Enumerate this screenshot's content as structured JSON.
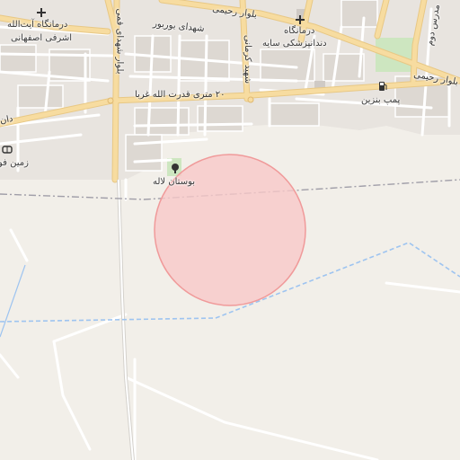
{
  "map": {
    "colors": {
      "land": "#f2efe9",
      "urban": "#e6e2dd",
      "block": "#dcd7d1",
      "major_road": "#f7dca0",
      "major_road_casing": "#e5c27d",
      "minor_road": "#ffffff",
      "park": "#cfe8c2",
      "railway": "#9c9aa6",
      "boundary": "#9ec4f0",
      "highlight_fill": "#f8c8c8",
      "highlight_stroke": "#f09a9a"
    },
    "labels": {
      "hospital_ayatollah_line1": "درمانگاه آیت‌الله",
      "hospital_ayatollah_line2": "اشرفی اصفهانی",
      "boulevard_rahimi_top": "بلوار رحیمی",
      "shohada_boroujer": "شهدای بوربور",
      "clinic_line1": "درمانگاه",
      "clinic_line2": "دندانپزشکی سایه",
      "street_20m": "۲۰ متری قدرت الله غربا",
      "gas_station": "پمپ بنزین",
      "boulevard_rahimi_right": "بلوار رحیمی",
      "shohada_qom_vertical": "بلوار شهدای قمی",
      "shohid_vertical": "شهید کرمانی",
      "madras_vertical": "مدرس دوم",
      "bostan_laleh": "بوستان لاله",
      "zamin_label": "زمین فو",
      "dana_label": "دان"
    },
    "icons": [
      "hospital-cross-icon",
      "clinic-cross-icon",
      "gas-pump-icon",
      "park-tree-icon",
      "sports-ground-icon"
    ]
  }
}
